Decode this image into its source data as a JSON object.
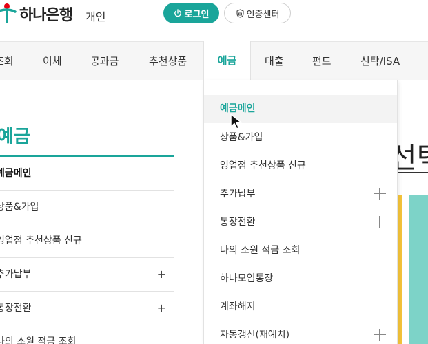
{
  "header": {
    "brand_name": "하나은행",
    "brand_sub": "개인",
    "login_label": "로그인",
    "cert_label": "인증센터"
  },
  "gnb": {
    "items": [
      "조회",
      "이체",
      "공과금",
      "추천상품",
      "예금",
      "대출",
      "펀드",
      "신탁/ISA"
    ],
    "active": "예금"
  },
  "sidebar": {
    "title": "예금",
    "items": [
      {
        "label": "예금메인",
        "expandable": false
      },
      {
        "label": "상품&가입",
        "expandable": false
      },
      {
        "label": "영업점 추천상품 신규",
        "expandable": false
      },
      {
        "label": "추가납부",
        "expandable": true,
        "toggle": "+"
      },
      {
        "label": "통장전환",
        "expandable": true,
        "toggle": "+"
      },
      {
        "label": "나의 소원 적금 조회",
        "expandable": false
      }
    ]
  },
  "dropdown": {
    "items": [
      {
        "label": "예금메인",
        "active": true,
        "expandable": false
      },
      {
        "label": "상품&가입",
        "active": false,
        "expandable": false
      },
      {
        "label": "영업점 추천상품 신규",
        "active": false,
        "expandable": false
      },
      {
        "label": "추가납부",
        "active": false,
        "expandable": true
      },
      {
        "label": "통장전환",
        "active": false,
        "expandable": true
      },
      {
        "label": "나의 소원 적금 조회",
        "active": false,
        "expandable": false
      },
      {
        "label": "하나모임통장",
        "active": false,
        "expandable": false
      },
      {
        "label": "계좌해지",
        "active": false,
        "expandable": false
      },
      {
        "label": "자동갱신(재예치)",
        "active": false,
        "expandable": true
      }
    ]
  },
  "main": {
    "heading_fragment": "선택"
  },
  "colors": {
    "brand_teal": "#1aa59a",
    "brand_red": "#e60012",
    "banner_yellow": "#f4c43b",
    "banner_teal": "#7dd3c8"
  }
}
